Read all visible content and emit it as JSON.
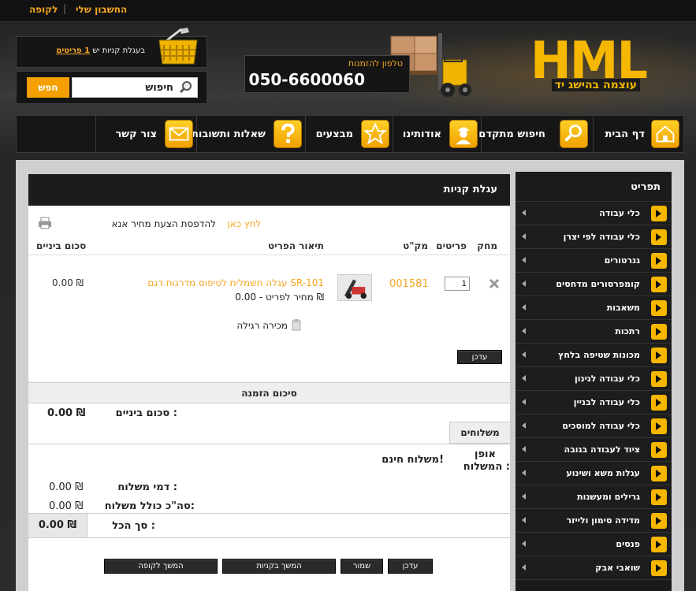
{
  "topbar": {
    "account_label": "החשבון שלי",
    "separator": "|",
    "checkout_label": "לקופה"
  },
  "header": {
    "logo_text": "HML",
    "logo_tagline": "עוצמה בהישג יד",
    "phone_label": "טלפון להזמנות",
    "phone_number": "050-6600060",
    "cart_prefix": "בעגלת קניות יש",
    "cart_count": "1",
    "cart_items_word": "פריטים",
    "search_placeholder": "חיפוש",
    "search_button": "חפש"
  },
  "nav": [
    {
      "label": "דף הבית",
      "icon": "home-icon"
    },
    {
      "label": "חיפוש מתקדם",
      "icon": "magnifier-icon"
    },
    {
      "label": "אודותינו",
      "icon": "worker-icon"
    },
    {
      "label": "מבצעים",
      "icon": "star-icon"
    },
    {
      "label": "שאלות ותשובות",
      "icon": "question-icon"
    },
    {
      "label": "צור קשר",
      "icon": "envelope-icon"
    }
  ],
  "sidebar": {
    "title": "תפריט",
    "items": [
      "כלי עבודה",
      "כלי עבודה לפי יצרן",
      "גנרטורים",
      "קומפרסורים מדחסים",
      "משאבות",
      "רתכות",
      "מכונות שטיפה בלחץ",
      "כלי עבודה לגינון",
      "כלי עבודה לבניין",
      "כלי עבודה למוסכים",
      "ציוד לעבודה בגובה",
      "עגלות משא ושינוע",
      "גרילים ומעשנות",
      "מדידה סימון ולייזר",
      "פנסים",
      "שואבי אבק"
    ]
  },
  "cart": {
    "title": "עגלת קניות",
    "print_text": "להדפסת הצעת מחיר אנא",
    "print_link": "לחץ כאן",
    "columns": {
      "delete": "מחק",
      "items": "פריטים",
      "sku": "מק\"ט",
      "description": "תיאור הפריט",
      "subtotal": "סכום ביניים"
    },
    "row": {
      "quantity": "1",
      "sku": "001581",
      "name": "עגלה חשמלית לטיפוס מדרגות דגם SR-101",
      "unit_price": "מחיר לפריט - 0.00 ₪",
      "subtotal": "0.00 ₪",
      "sale_type": "מכירה רגילה"
    },
    "update_button": "עדכן"
  },
  "summary": {
    "title": "סיכום הזמנה",
    "subtotal_label": "סכום ביניים :",
    "subtotal_value": "0.00 ₪",
    "shipping_tab": "משלוחים",
    "shipping_method_label_1": "אופן",
    "shipping_method_label_2": "המשלוח :",
    "shipping_method_value": "משלוח חינם!",
    "shipping_fee_label": "דמי משלוח :",
    "shipping_fee_value": "0.00 ₪",
    "total_incl_label": "סה\"כ כולל משלוח:",
    "total_incl_value": "0.00 ₪",
    "grand_total_label": "סך הכל :",
    "grand_total_value": "0.00 ₪"
  },
  "actions": {
    "update": "עדכן",
    "save": "שמור",
    "continue_shopping": "המשך בקניות",
    "checkout": "המשך לקופה"
  },
  "colors": {
    "accent": "#f5a623",
    "brand_yellow": "#f5b700",
    "dark": "#1b1b1b"
  }
}
